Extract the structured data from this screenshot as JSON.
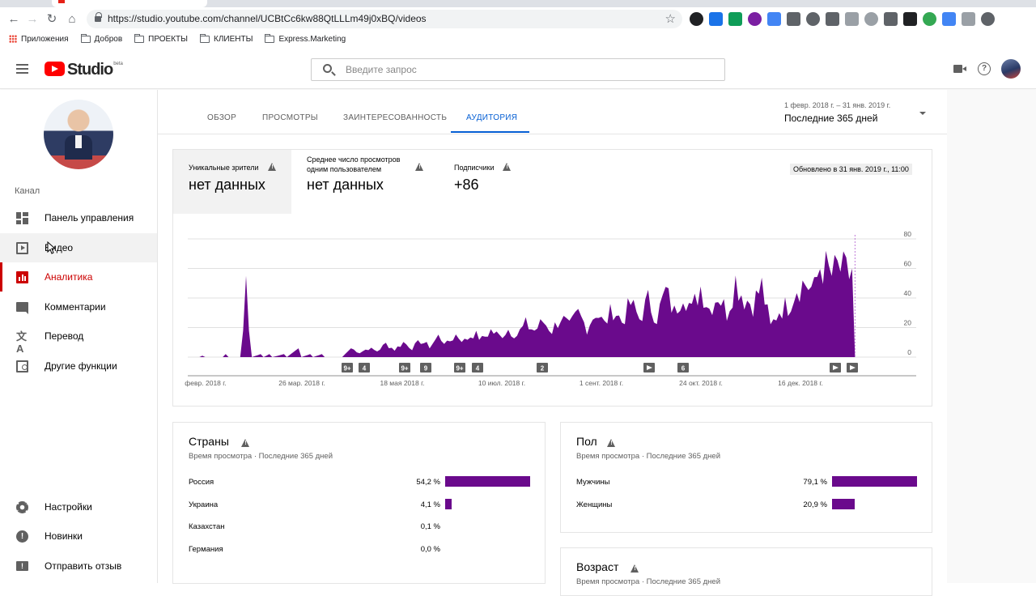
{
  "browser": {
    "url": "https://studio.youtube.com/channel/UCBtCc6kw88QtLLLm49j0xBQ/videos",
    "bookmarks": [
      "Приложения",
      "Добров",
      "ПРОЕКТЫ",
      "КЛИЕНТЫ",
      "Express.Marketing"
    ],
    "extension_colors": [
      "#202124",
      "#1a73e8",
      "#0f9d58",
      "#7b1fa2",
      "#4285f4",
      "#5f6368",
      "#5f6368",
      "#5f6368",
      "#9aa0a6",
      "#9aa0a6",
      "#5f6368",
      "#202124",
      "#34a853",
      "#4285f4",
      "#9aa0a6",
      "#5f6368"
    ]
  },
  "header": {
    "logo_text": "Studio",
    "logo_badge": "beta",
    "search_placeholder": "Введите запрос"
  },
  "sidebar": {
    "section_label": "Канал",
    "items": [
      {
        "label": "Панель управления",
        "icon": "dashboard-icon"
      },
      {
        "label": "Видео",
        "icon": "video-icon"
      },
      {
        "label": "Аналитика",
        "icon": "analytics-icon"
      },
      {
        "label": "Комментарии",
        "icon": "comments-icon"
      },
      {
        "label": "Перевод",
        "icon": "translate-icon"
      },
      {
        "label": "Другие функции",
        "icon": "other-features-icon"
      }
    ],
    "bottom_items": [
      {
        "label": "Настройки",
        "icon": "settings-icon"
      },
      {
        "label": "Новинки",
        "icon": "news-icon"
      },
      {
        "label": "Отправить отзыв",
        "icon": "feedback-icon"
      }
    ],
    "translate_glyph": "文A"
  },
  "tabs": [
    "ОБЗОР",
    "ПРОСМОТРЫ",
    "ЗАИНТЕРЕСОВАННОСТЬ",
    "АУДИТОРИЯ"
  ],
  "active_tab": "АУДИТОРИЯ",
  "date_range": {
    "dates": "1 февр. 2018 г. – 31 янв. 2019 г.",
    "label": "Последние 365 дней"
  },
  "metrics": {
    "unique_viewers": {
      "label": "Уникальные зрители",
      "value": "нет данных"
    },
    "avg_views_line1": "Среднее число просмотров",
    "avg_views_line2": "одним пользователем",
    "avg_views_value": "нет данных",
    "subscribers": {
      "label": "Подписчики",
      "value": "+86"
    },
    "updated": "Обновлено в 31 янв. 2019 г., 11:00"
  },
  "chart_data": {
    "type": "area",
    "color": "#6a0a8c",
    "ylim": [
      0,
      80
    ],
    "y_ticks": [
      "80",
      "60",
      "40",
      "20",
      "0"
    ],
    "x_tick_labels": [
      "февр. 2018 г.",
      "26 мар. 2018 г.",
      "18 мая 2018 г.",
      "10 июл. 2018 г.",
      "1 сент. 2018 г.",
      "24 окт. 2018 г.",
      "16 дек. 2018 г."
    ],
    "keypoints": [
      [
        0,
        0
      ],
      [
        4,
        0
      ],
      [
        5,
        1
      ],
      [
        6,
        0
      ],
      [
        12,
        0
      ],
      [
        13,
        2
      ],
      [
        14,
        0
      ],
      [
        18,
        0
      ],
      [
        19,
        18
      ],
      [
        20,
        55
      ],
      [
        21,
        18
      ],
      [
        22,
        0
      ],
      [
        25,
        2
      ],
      [
        26,
        0
      ],
      [
        28,
        2
      ],
      [
        29,
        0
      ],
      [
        33,
        2
      ],
      [
        34,
        0
      ],
      [
        38,
        6
      ],
      [
        39,
        0
      ],
      [
        42,
        2
      ],
      [
        43,
        0
      ],
      [
        46,
        2
      ],
      [
        47,
        0
      ],
      [
        53,
        0
      ],
      [
        56,
        6
      ],
      [
        59,
        3
      ],
      [
        62,
        6
      ],
      [
        65,
        4
      ],
      [
        68,
        9
      ],
      [
        71,
        5
      ],
      [
        74,
        10
      ],
      [
        77,
        6
      ],
      [
        80,
        11
      ],
      [
        83,
        7
      ],
      [
        86,
        14
      ],
      [
        89,
        9
      ],
      [
        92,
        15
      ],
      [
        95,
        11
      ],
      [
        98,
        16
      ],
      [
        101,
        12
      ],
      [
        104,
        18
      ],
      [
        107,
        14
      ],
      [
        110,
        19
      ],
      [
        113,
        15
      ],
      [
        116,
        22
      ],
      [
        119,
        18
      ],
      [
        122,
        24
      ],
      [
        125,
        18
      ],
      [
        128,
        27
      ],
      [
        131,
        20
      ],
      [
        134,
        29
      ],
      [
        137,
        20
      ],
      [
        140,
        31
      ],
      [
        143,
        22
      ],
      [
        146,
        33
      ],
      [
        149,
        24
      ],
      [
        152,
        36
      ],
      [
        155,
        26
      ],
      [
        158,
        38
      ],
      [
        161,
        27
      ],
      [
        164,
        44
      ],
      [
        167,
        30
      ],
      [
        170,
        46
      ],
      [
        173,
        31
      ],
      [
        176,
        48
      ],
      [
        179,
        33
      ],
      [
        182,
        43
      ],
      [
        185,
        30
      ],
      [
        188,
        52
      ],
      [
        191,
        40
      ],
      [
        194,
        36
      ],
      [
        197,
        48
      ],
      [
        200,
        20
      ],
      [
        203,
        32
      ],
      [
        206,
        35
      ],
      [
        209,
        48
      ],
      [
        212,
        50
      ],
      [
        215,
        45
      ],
      [
        217,
        62
      ],
      [
        219,
        60
      ],
      [
        221,
        55
      ],
      [
        223,
        60
      ],
      [
        225,
        58
      ],
      [
        227,
        55
      ],
      [
        228,
        60
      ],
      [
        229,
        0
      ]
    ],
    "x_max": 250,
    "event_markers": [
      "9+",
      "4",
      "9+",
      "9",
      "9+",
      "4",
      "2",
      "play",
      "6",
      "play",
      "play"
    ]
  },
  "countries": {
    "title": "Страны",
    "subtitle": "Время просмотра · Последние 365 дней",
    "rows": [
      {
        "name": "Россия",
        "pct": "54,2 %",
        "value": 54.2
      },
      {
        "name": "Украина",
        "pct": "4,1 %",
        "value": 4.1
      },
      {
        "name": "Казахстан",
        "pct": "0,1 %",
        "value": 0.1
      },
      {
        "name": "Германия",
        "pct": "0,0 %",
        "value": 0.0
      }
    ]
  },
  "gender": {
    "title": "Пол",
    "subtitle": "Время просмотра · Последние 365 дней",
    "rows": [
      {
        "name": "Мужчины",
        "pct": "79,1 %",
        "value": 79.1
      },
      {
        "name": "Женщины",
        "pct": "20,9 %",
        "value": 20.9
      }
    ]
  },
  "age": {
    "title": "Возраст",
    "subtitle": "Время просмотра · Последние 365 дней"
  }
}
